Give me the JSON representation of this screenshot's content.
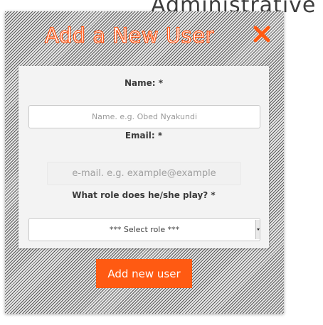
{
  "background": {
    "heading": "Administrative S"
  },
  "modal": {
    "title": "Add a New User",
    "close_icon": "close-icon",
    "accent_color": "#ff5a12"
  },
  "form": {
    "name": {
      "label": "Name: *",
      "value": "",
      "placeholder": "Name. e.g. Obed Nyakundi"
    },
    "email": {
      "label": "Email: *",
      "value": "",
      "placeholder": "e-mail. e.g. example@example"
    },
    "role": {
      "label": "What role does he/she play? *",
      "selected": "*** Select role ***"
    },
    "submit_label": "Add new user"
  }
}
